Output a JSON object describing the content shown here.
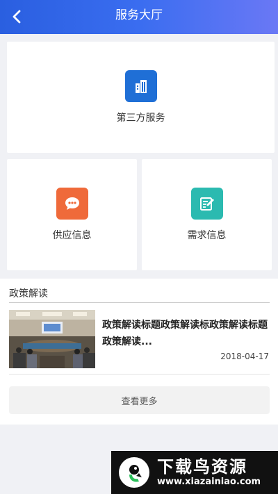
{
  "header": {
    "title": "服务大厅",
    "back_icon": "chevron-left-icon"
  },
  "cards": {
    "third_party": {
      "label": "第三方服务",
      "icon": "building-icon",
      "color": "#1f6fd6"
    },
    "supply": {
      "label": "供应信息",
      "icon": "chat-bubble-icon",
      "color": "#ef6a3a"
    },
    "demand": {
      "label": "需求信息",
      "icon": "document-edit-icon",
      "color": "#2bbab0"
    }
  },
  "policy": {
    "section_title": "政策解读",
    "items": [
      {
        "title": "政策解读标题政策解读标政策解读标题政策解读...",
        "date": "2018-04-17"
      }
    ],
    "more_label": "查看更多"
  },
  "watermark": {
    "name": "下载鸟资源",
    "url": "www.xiazainiao.com"
  }
}
